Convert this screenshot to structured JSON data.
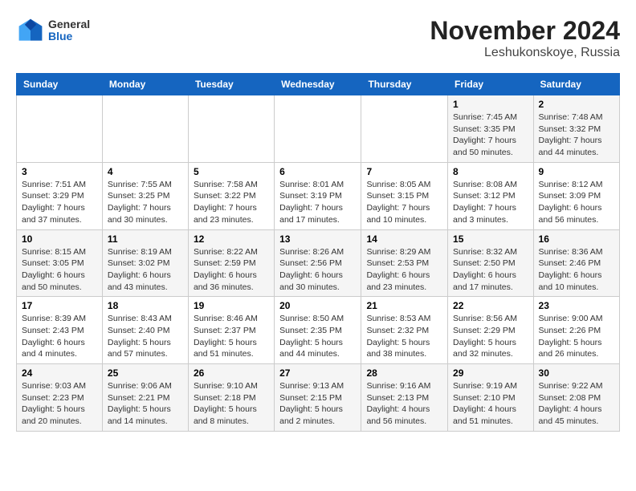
{
  "logo": {
    "general": "General",
    "blue": "Blue"
  },
  "title": "November 2024",
  "subtitle": "Leshukonskoye, Russia",
  "days_of_week": [
    "Sunday",
    "Monday",
    "Tuesday",
    "Wednesday",
    "Thursday",
    "Friday",
    "Saturday"
  ],
  "weeks": [
    [
      {
        "day": "",
        "info": ""
      },
      {
        "day": "",
        "info": ""
      },
      {
        "day": "",
        "info": ""
      },
      {
        "day": "",
        "info": ""
      },
      {
        "day": "",
        "info": ""
      },
      {
        "day": "1",
        "info": "Sunrise: 7:45 AM\nSunset: 3:35 PM\nDaylight: 7 hours\nand 50 minutes."
      },
      {
        "day": "2",
        "info": "Sunrise: 7:48 AM\nSunset: 3:32 PM\nDaylight: 7 hours\nand 44 minutes."
      }
    ],
    [
      {
        "day": "3",
        "info": "Sunrise: 7:51 AM\nSunset: 3:29 PM\nDaylight: 7 hours\nand 37 minutes."
      },
      {
        "day": "4",
        "info": "Sunrise: 7:55 AM\nSunset: 3:25 PM\nDaylight: 7 hours\nand 30 minutes."
      },
      {
        "day": "5",
        "info": "Sunrise: 7:58 AM\nSunset: 3:22 PM\nDaylight: 7 hours\nand 23 minutes."
      },
      {
        "day": "6",
        "info": "Sunrise: 8:01 AM\nSunset: 3:19 PM\nDaylight: 7 hours\nand 17 minutes."
      },
      {
        "day": "7",
        "info": "Sunrise: 8:05 AM\nSunset: 3:15 PM\nDaylight: 7 hours\nand 10 minutes."
      },
      {
        "day": "8",
        "info": "Sunrise: 8:08 AM\nSunset: 3:12 PM\nDaylight: 7 hours\nand 3 minutes."
      },
      {
        "day": "9",
        "info": "Sunrise: 8:12 AM\nSunset: 3:09 PM\nDaylight: 6 hours\nand 56 minutes."
      }
    ],
    [
      {
        "day": "10",
        "info": "Sunrise: 8:15 AM\nSunset: 3:05 PM\nDaylight: 6 hours\nand 50 minutes."
      },
      {
        "day": "11",
        "info": "Sunrise: 8:19 AM\nSunset: 3:02 PM\nDaylight: 6 hours\nand 43 minutes."
      },
      {
        "day": "12",
        "info": "Sunrise: 8:22 AM\nSunset: 2:59 PM\nDaylight: 6 hours\nand 36 minutes."
      },
      {
        "day": "13",
        "info": "Sunrise: 8:26 AM\nSunset: 2:56 PM\nDaylight: 6 hours\nand 30 minutes."
      },
      {
        "day": "14",
        "info": "Sunrise: 8:29 AM\nSunset: 2:53 PM\nDaylight: 6 hours\nand 23 minutes."
      },
      {
        "day": "15",
        "info": "Sunrise: 8:32 AM\nSunset: 2:50 PM\nDaylight: 6 hours\nand 17 minutes."
      },
      {
        "day": "16",
        "info": "Sunrise: 8:36 AM\nSunset: 2:46 PM\nDaylight: 6 hours\nand 10 minutes."
      }
    ],
    [
      {
        "day": "17",
        "info": "Sunrise: 8:39 AM\nSunset: 2:43 PM\nDaylight: 6 hours\nand 4 minutes."
      },
      {
        "day": "18",
        "info": "Sunrise: 8:43 AM\nSunset: 2:40 PM\nDaylight: 5 hours\nand 57 minutes."
      },
      {
        "day": "19",
        "info": "Sunrise: 8:46 AM\nSunset: 2:37 PM\nDaylight: 5 hours\nand 51 minutes."
      },
      {
        "day": "20",
        "info": "Sunrise: 8:50 AM\nSunset: 2:35 PM\nDaylight: 5 hours\nand 44 minutes."
      },
      {
        "day": "21",
        "info": "Sunrise: 8:53 AM\nSunset: 2:32 PM\nDaylight: 5 hours\nand 38 minutes."
      },
      {
        "day": "22",
        "info": "Sunrise: 8:56 AM\nSunset: 2:29 PM\nDaylight: 5 hours\nand 32 minutes."
      },
      {
        "day": "23",
        "info": "Sunrise: 9:00 AM\nSunset: 2:26 PM\nDaylight: 5 hours\nand 26 minutes."
      }
    ],
    [
      {
        "day": "24",
        "info": "Sunrise: 9:03 AM\nSunset: 2:23 PM\nDaylight: 5 hours\nand 20 minutes."
      },
      {
        "day": "25",
        "info": "Sunrise: 9:06 AM\nSunset: 2:21 PM\nDaylight: 5 hours\nand 14 minutes."
      },
      {
        "day": "26",
        "info": "Sunrise: 9:10 AM\nSunset: 2:18 PM\nDaylight: 5 hours\nand 8 minutes."
      },
      {
        "day": "27",
        "info": "Sunrise: 9:13 AM\nSunset: 2:15 PM\nDaylight: 5 hours\nand 2 minutes."
      },
      {
        "day": "28",
        "info": "Sunrise: 9:16 AM\nSunset: 2:13 PM\nDaylight: 4 hours\nand 56 minutes."
      },
      {
        "day": "29",
        "info": "Sunrise: 9:19 AM\nSunset: 2:10 PM\nDaylight: 4 hours\nand 51 minutes."
      },
      {
        "day": "30",
        "info": "Sunrise: 9:22 AM\nSunset: 2:08 PM\nDaylight: 4 hours\nand 45 minutes."
      }
    ]
  ]
}
